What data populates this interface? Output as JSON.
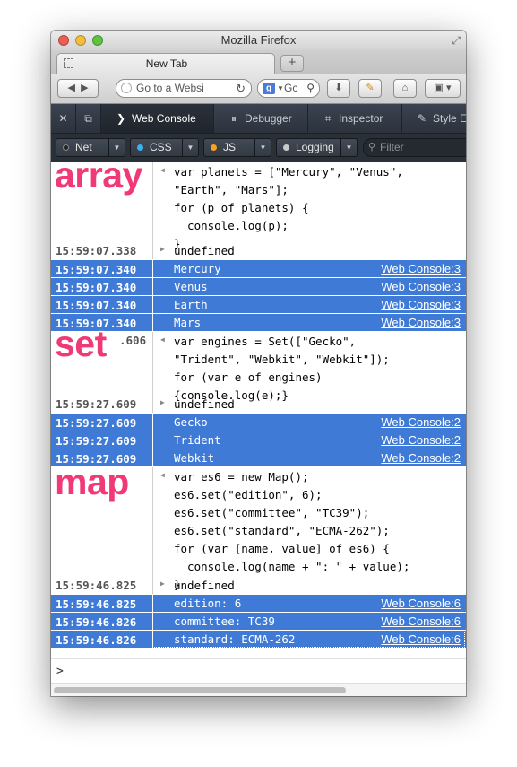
{
  "window": {
    "title": "Mozilla Firefox"
  },
  "tabs": [
    {
      "label": "New Tab"
    }
  ],
  "navbar": {
    "back_icon": "back-arrow-icon",
    "forward_icon": "forward-arrow-icon",
    "url_placeholder": "Go to a Websi",
    "search_engine": "g",
    "search_placeholder": "Gc"
  },
  "devtools": {
    "tabs": [
      {
        "label": "Web Console",
        "icon": "terminal-icon",
        "active": true
      },
      {
        "label": "Debugger",
        "icon": "pause-icon"
      },
      {
        "label": "Inspector",
        "icon": "inspector-icon"
      },
      {
        "label": "Style E",
        "icon": "style-editor-icon"
      }
    ],
    "filters": [
      {
        "label": "Net",
        "color": "#222222"
      },
      {
        "label": "CSS",
        "color": "#3bb0ee"
      },
      {
        "label": "JS",
        "color": "#f7a024"
      },
      {
        "label": "Logging",
        "color": "#c9c9c9"
      }
    ],
    "filter_placeholder": "Filter"
  },
  "annotations": {
    "array": "array",
    "set": "set",
    "map": "map"
  },
  "console": {
    "array_input": "var planets = [\"Mercury\", \"Venus\",\n\"Earth\", \"Mars\"];\nfor (p of planets) {\n  console.log(p);\n}",
    "array_result": {
      "ts": "15:59:07.338",
      "text": "undefined"
    },
    "array_logs": [
      {
        "ts": "15:59:07.340",
        "text": "Mercury",
        "src": "Web Console:3"
      },
      {
        "ts": "15:59:07.340",
        "text": "Venus",
        "src": "Web Console:3"
      },
      {
        "ts": "15:59:07.340",
        "text": "Earth",
        "src": "Web Console:3"
      },
      {
        "ts": "15:59:07.340",
        "text": "Mars",
        "src": "Web Console:3"
      }
    ],
    "set_input_ts": ".606",
    "set_input": "var engines = Set([\"Gecko\",\n\"Trident\", \"Webkit\", \"Webkit\"]);\nfor (var e of engines)\n{console.log(e);}",
    "set_result": {
      "ts": "15:59:27.609",
      "text": "undefined"
    },
    "set_logs": [
      {
        "ts": "15:59:27.609",
        "text": "Gecko",
        "src": "Web Console:2"
      },
      {
        "ts": "15:59:27.609",
        "text": "Trident",
        "src": "Web Console:2"
      },
      {
        "ts": "15:59:27.609",
        "text": "Webkit",
        "src": "Web Console:2"
      }
    ],
    "map_input": "var es6 = new Map();\nes6.set(\"edition\", 6);\nes6.set(\"committee\", \"TC39\");\nes6.set(\"standard\", \"ECMA-262\");\nfor (var [name, value] of es6) {\n  console.log(name + \": \" + value);\n}",
    "map_result": {
      "ts": "15:59:46.825",
      "text": "undefined"
    },
    "map_logs": [
      {
        "ts": "15:59:46.825",
        "text": "edition: 6",
        "src": "Web Console:6"
      },
      {
        "ts": "15:59:46.826",
        "text": "committee: TC39",
        "src": "Web Console:6"
      },
      {
        "ts": "15:59:46.826",
        "text": "standard: ECMA-262",
        "src": "Web Console:6"
      }
    ],
    "prompt": ">"
  }
}
